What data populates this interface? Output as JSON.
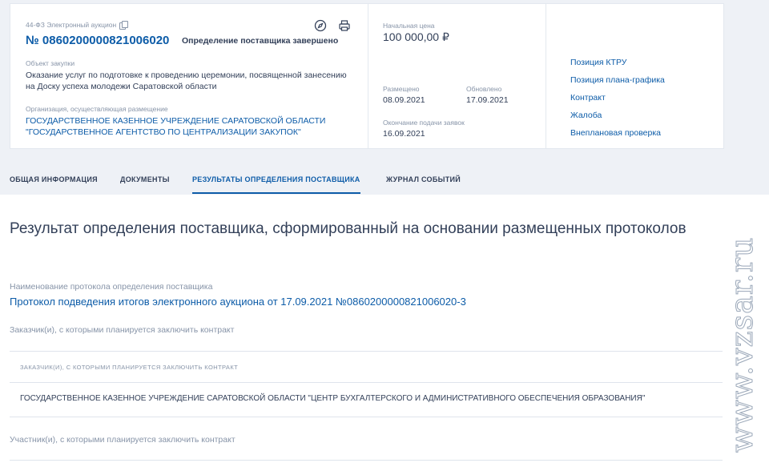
{
  "header": {
    "procurement_type": "44-ФЗ Электронный аукцион",
    "reg_number": "№ 0860200000821006020",
    "status": "Определение поставщика завершено",
    "object_label": "Объект закупки",
    "object_value": "Оказание услуг по подготовке к проведению церемонии, посвященной занесению на Доску успеха молодежи Саратовской области",
    "org_label": "Организация, осуществляющая размещение",
    "org_value": "ГОСУДАРСТВЕННОЕ КАЗЕННОЕ УЧРЕЖДЕНИЕ САРАТОВСКОЙ ОБЛАСТИ \"ГОСУДАРСТВЕННОЕ АГЕНТСТВО ПО ЦЕНТРАЛИЗАЦИИ ЗАКУПОК\"",
    "price_label": "Начальная цена",
    "price_value": "100 000,00 ₽",
    "placed_label": "Размещено",
    "placed_value": "08.09.2021",
    "updated_label": "Обновлено",
    "updated_value": "17.09.2021",
    "deadline_label": "Окончание подачи заявок",
    "deadline_value": "16.09.2021"
  },
  "side_links": [
    "Позиция КТРУ",
    "Позиция плана-графика",
    "Контракт",
    "Жалоба",
    "Внеплановая проверка"
  ],
  "tabs": [
    "ОБЩАЯ ИНФОРМАЦИЯ",
    "ДОКУМЕНТЫ",
    "РЕЗУЛЬТАТЫ ОПРЕДЕЛЕНИЯ ПОСТАВЩИКА",
    "ЖУРНАЛ СОБЫТИЙ"
  ],
  "main": {
    "title": "Результат определения поставщика, сформированный на основании размещенных протоколов",
    "protocol_label": "Наименование протокола определения поставщика",
    "protocol_link": "Протокол подведения итогов электронного аукциона от 17.09.2021 №0860200000821006020-3",
    "customers_label": "Заказчик(и), с которыми планируется заключить контракт",
    "table_header": "ЗАКАЗЧИК(И), С КОТОРЫМИ ПЛАНИРУЕТСЯ ЗАКЛЮЧИТЬ КОНТРАКТ",
    "table_row": "ГОСУДАРСТВЕННОЕ КАЗЕННОЕ УЧРЕЖДЕНИЕ САРАТОВСКОЙ ОБЛАСТИ \"ЦЕНТР БУХГАЛТЕРСКОГО И АДМИНИСТРАТИВНОГО ОБЕСПЕЧЕНИЯ ОБРАЗОВАНИЯ\"",
    "participants_label": "Участник(и), с которыми планируется заключить контракт"
  },
  "watermark": "www.vzsar.ru",
  "colors": {
    "accent": "#0d5ca8",
    "text": "#334059",
    "muted": "#8794a8",
    "band": "#eef1f6"
  }
}
